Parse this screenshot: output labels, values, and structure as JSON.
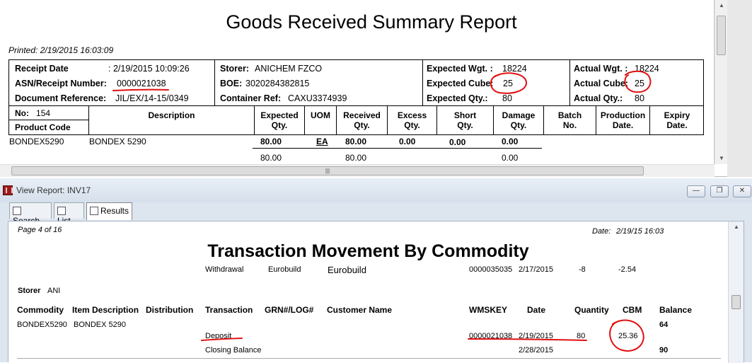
{
  "top_report": {
    "title": "Goods Received Summary Report",
    "printed": "Printed:  2/19/2015 16:03:09",
    "header": {
      "receipt_date_label": "Receipt Date",
      "receipt_date_value": ": 2/19/2015 10:09:26",
      "asn_label": "ASN/Receipt Number:",
      "asn_value": "0000021038",
      "doc_ref_label": "Document Reference:",
      "doc_ref_value": "JIL/EX/14-15/0349",
      "storer_label": "Storer:",
      "storer_value": "ANICHEM FZCO",
      "boe_label": "BOE:",
      "boe_value": "3020284382815",
      "container_label": "Container Ref:",
      "container_value": "CAXU3374939",
      "exp_wgt_label": "Expected Wgt. :",
      "exp_wgt_value": "18224",
      "exp_cube_label": "Expected Cube:",
      "exp_cube_value": "25",
      "exp_qty_label": "Expected Qty.:",
      "exp_qty_value": "80",
      "act_wgt_label": "Actual Wgt. :",
      "act_wgt_value": "18224",
      "act_cube_label": "Actual Cube:",
      "act_cube_value": "25",
      "act_qty_label": "Actual Qty.:",
      "act_qty_value": "80"
    },
    "columns": {
      "no_label": "No:",
      "no_value": "154",
      "product_code": "Product Code",
      "description": "Description",
      "expected_qty_1": "Expected",
      "expected_qty_2": "Qty.",
      "uom": "UOM",
      "received_qty_1": "Received",
      "received_qty_2": "Qty.",
      "excess_qty_1": "Excess",
      "excess_qty_2": "Qty.",
      "short_qty_1": "Short",
      "short_qty_2": "Qty.",
      "damage_qty_1": "Damage",
      "damage_qty_2": "Qty.",
      "batch_no_1": "Batch",
      "batch_no_2": "No.",
      "production_date_1": "Production",
      "production_date_2": "Date.",
      "expiry_date_1": "Expiry",
      "expiry_date_2": "Date."
    },
    "row": {
      "product_code": "BONDEX5290",
      "description": "BONDEX 5290",
      "expected_qty": "80.00",
      "uom": "EA",
      "received_qty": "80.00",
      "excess_qty": "0.00",
      "short_qty": "0.00",
      "damage_qty": "0.00"
    },
    "totals": {
      "expected_qty": "80.00",
      "received_qty": "80.00",
      "damage_qty": "0.00"
    }
  },
  "window": {
    "title": "View Report: INV17",
    "minimize": "—",
    "restore": "❐",
    "close": "✕",
    "tabs": [
      {
        "label": "Search"
      },
      {
        "label": "List"
      },
      {
        "label": "Results"
      }
    ]
  },
  "bottom_report": {
    "page": "Page 4 of 16",
    "date_label": "Date:",
    "date_value": "2/19/15 16:03",
    "title": "Transaction Movement By Commodity",
    "carry_row": {
      "transaction": "Withdrawal",
      "distribution": "Eurobuild",
      "customer": "Eurobuild",
      "wmskey": "0000035035",
      "date": "2/17/2015",
      "quantity": "-8",
      "cbm": "-2.54"
    },
    "storer_label": "Storer",
    "storer_value": "ANI",
    "headers": {
      "commodity": "Commodity",
      "item_description": "Item Description",
      "distribution": "Distribution",
      "transaction": "Transaction",
      "grn": "GRN#/LOG#",
      "customer": "Customer Name",
      "wmskey": "WMSKEY",
      "date": "Date",
      "quantity": "Quantity",
      "cbm": "CBM",
      "balance": "Balance"
    },
    "commodity_row": {
      "commodity": "BONDEX5290",
      "item_description": "BONDEX 5290",
      "balance": "64"
    },
    "deposit_row": {
      "transaction": "Deposit",
      "wmskey": "0000021038",
      "date": "2/19/2015",
      "quantity": "80",
      "cbm": "25.36"
    },
    "closing_row": {
      "transaction": "Closing Balance",
      "date": "2/28/2015",
      "balance": "90"
    }
  },
  "annotation_color": "#e01010"
}
